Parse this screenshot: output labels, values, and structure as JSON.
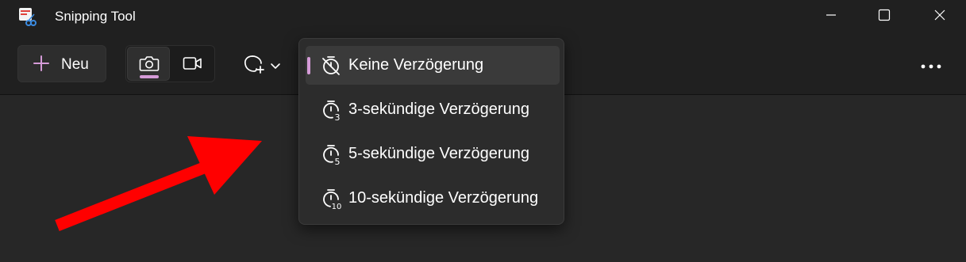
{
  "window": {
    "title": "Snipping Tool",
    "controls": [
      "minimize-icon",
      "maximize-icon",
      "close-icon"
    ]
  },
  "toolbar": {
    "new_label": "Neu",
    "icons": [
      "plus-icon",
      "camera-icon",
      "video-icon",
      "shape-icon",
      "chevron-down-icon",
      "more-icon"
    ]
  },
  "delay_menu": {
    "items": [
      {
        "label": "Keine Verzögerung",
        "icon": "timer-off-icon",
        "selected": true
      },
      {
        "label": "3-sekündige Verzögerung",
        "icon": "timer-3-icon",
        "selected": false
      },
      {
        "label": "5-sekündige Verzögerung",
        "icon": "timer-5-icon",
        "selected": false
      },
      {
        "label": "10-sekündige Verzögerung",
        "icon": "timer-10-icon",
        "selected": false
      }
    ]
  },
  "colors": {
    "accent": "#d59bd8",
    "annotation_arrow": "#ff0000",
    "background": "#202020"
  }
}
